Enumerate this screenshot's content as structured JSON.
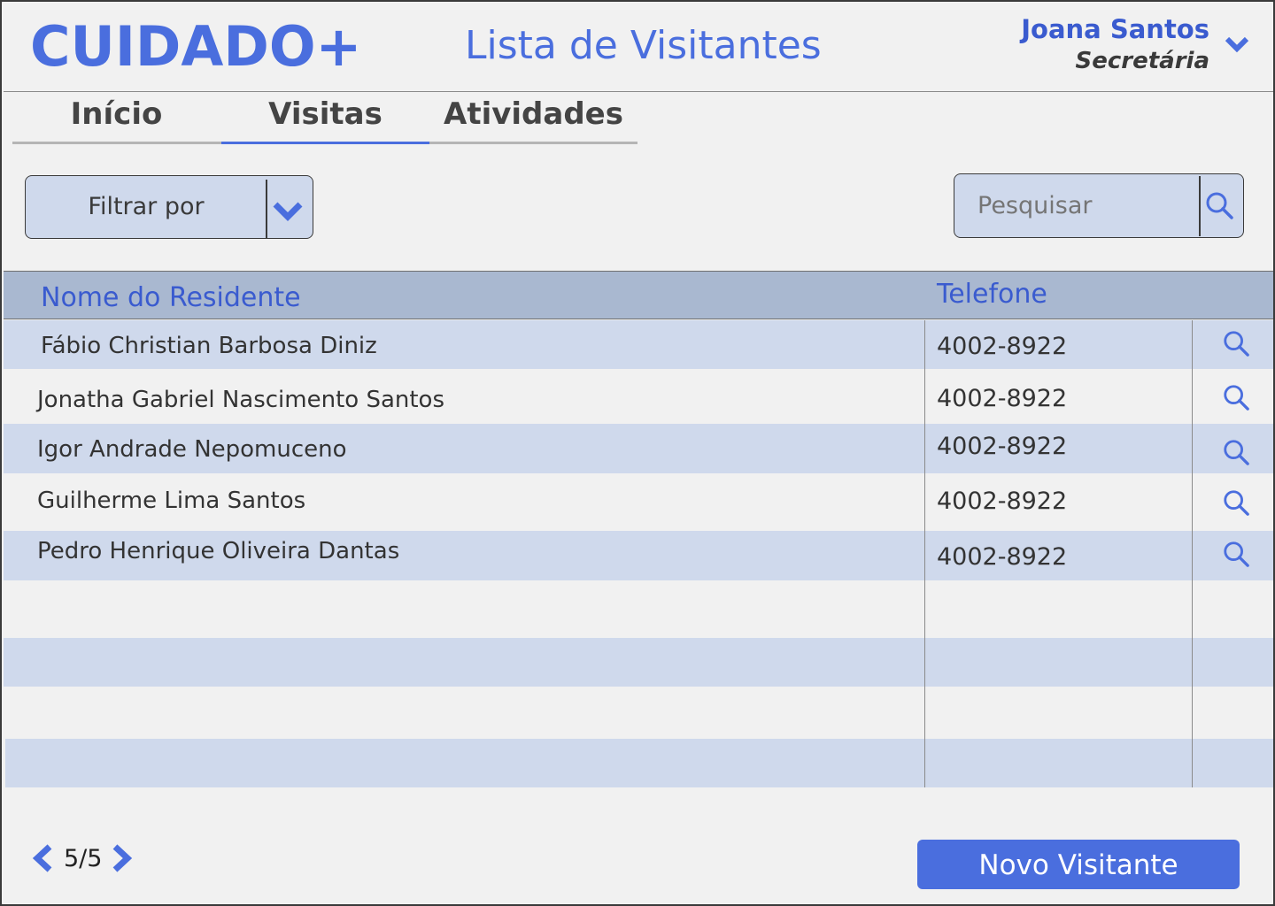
{
  "header": {
    "logo": "CUIDADO+",
    "title": "Lista de Visitantes",
    "user": {
      "name": "Joana Santos",
      "role": "Secretária"
    }
  },
  "tabs": [
    {
      "label": "Início",
      "active": false
    },
    {
      "label": "Visitas",
      "active": true
    },
    {
      "label": "Atividades",
      "active": false
    }
  ],
  "filter": {
    "label": "Filtrar por"
  },
  "search": {
    "placeholder": "Pesquisar"
  },
  "table": {
    "headers": {
      "name": "Nome do Residente",
      "phone": "Telefone"
    },
    "rows": [
      {
        "name": "Fábio Christian Barbosa Diniz",
        "phone": "4002-8922"
      },
      {
        "name": "Jonatha Gabriel Nascimento Santos",
        "phone": "4002-8922"
      },
      {
        "name": "Igor Andrade Nepomuceno",
        "phone": "4002-8922"
      },
      {
        "name": "Guilherme Lima Santos",
        "phone": "4002-8922"
      },
      {
        "name": "Pedro Henrique Oliveira Dantas",
        "phone": "4002-8922"
      }
    ]
  },
  "pagination": {
    "label": "5/5"
  },
  "actions": {
    "new_visitor": "Novo Visitante"
  },
  "colors": {
    "accent": "#4a6ede",
    "row_alt": "#cfd9ec",
    "header_bg": "#a9b8d0",
    "background": "#f1f1f1"
  },
  "icons": {
    "user_menu": "chevron-down-icon",
    "filter": "chevron-down-icon",
    "search": "search-icon",
    "row_action": "search-icon",
    "prev": "chevron-left-icon",
    "next": "chevron-right-icon"
  }
}
